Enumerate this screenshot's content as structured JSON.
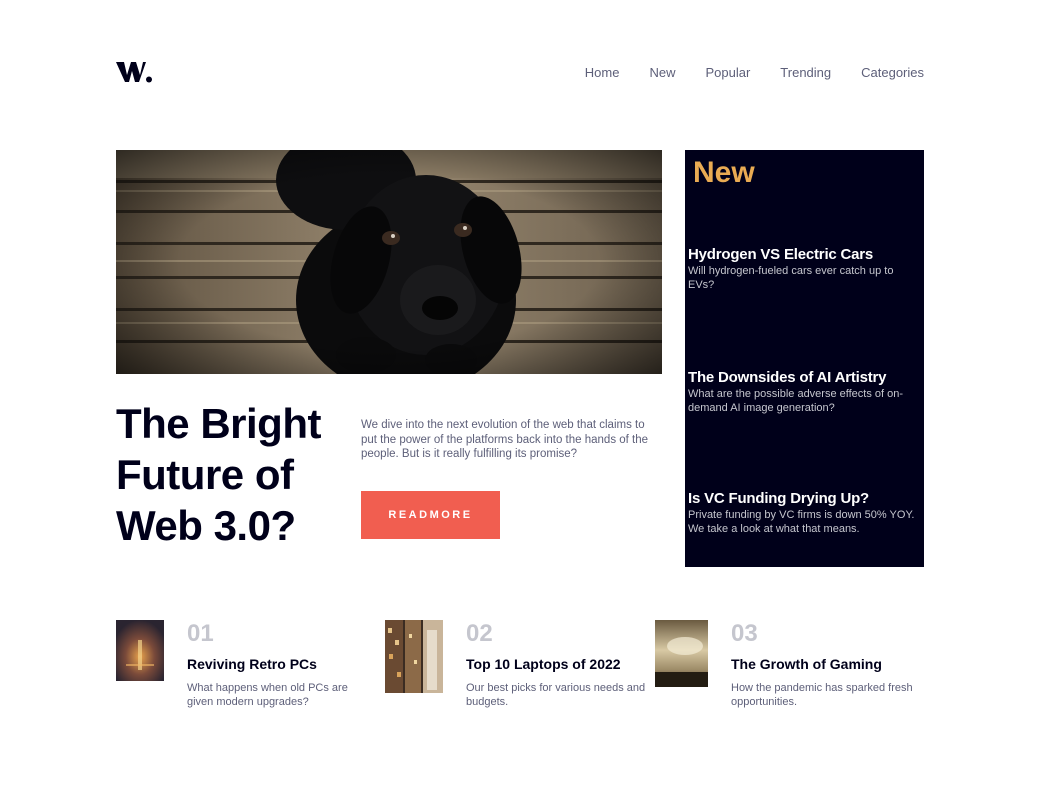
{
  "brand": {
    "logo_text": "W."
  },
  "nav": [
    "Home",
    "New",
    "Popular",
    "Trending",
    "Categories"
  ],
  "hero": {
    "title": "The Bright Future of Web 3.0?",
    "description": "We dive into the next evolution of the web that claims to put the power of the platforms back into the hands of the people. But is it really fulfilling its promise?",
    "button_label": "READMORE",
    "image": "black-puppy-on-wooden-floor"
  },
  "new_panel": {
    "heading": "New",
    "items": [
      {
        "title": "Hydrogen VS Electric Cars",
        "desc": "Will hydrogen-fueled cars ever catch up to EVs?"
      },
      {
        "title": "The Downsides of AI Artistry",
        "desc": "What are the possible adverse effects of on-demand AI image generation?"
      },
      {
        "title": "Is VC Funding Drying Up?",
        "desc": "Private funding by VC firms is down 50% YOY. We take a look at what that means."
      }
    ]
  },
  "articles": [
    {
      "number": "01",
      "title": "Reviving Retro PCs",
      "desc": "What happens when old PCs are given modern upgrades?",
      "image": "retro-pc-thumbnail"
    },
    {
      "number": "02",
      "title": "Top 10 Laptops of 2022",
      "desc": "Our best picks for various needs and budgets.",
      "image": "laptops-thumbnail"
    },
    {
      "number": "03",
      "title": "The Growth of Gaming",
      "desc": "How the pandemic has sparked fresh opportunities.",
      "image": "gaming-thumbnail"
    }
  ],
  "colors": {
    "dark_navy": "#00001a",
    "soft_orange": "#e9ab53",
    "soft_red": "#f15e50",
    "grayish_blue": "#c5c6ce",
    "dark_grayish_blue": "#5d5f79"
  }
}
